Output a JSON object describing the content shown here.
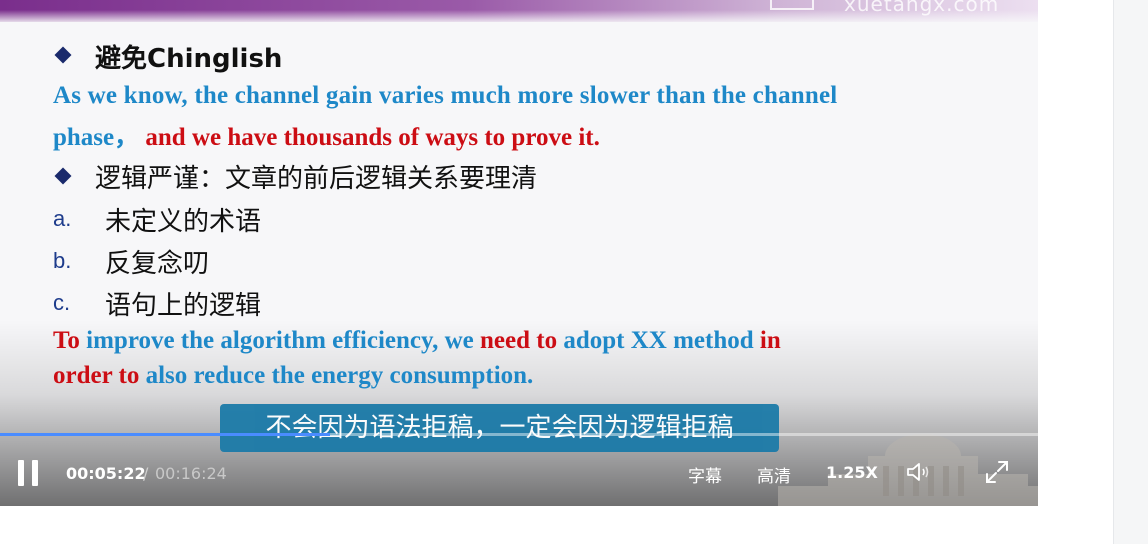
{
  "watermark": "xuetangx.com",
  "slide": {
    "heading1": "避免Chinglish",
    "example1_blue": "As we know, the channel gain varies much more slower than the channel",
    "example1_blue2": "phase，",
    "example1_red": "and we have thousands of ways to prove it.",
    "heading2": "逻辑严谨：文章的前后逻辑关系要理清",
    "items": [
      {
        "letter": "a.",
        "text": "未定义的术语"
      },
      {
        "letter": "b.",
        "text": "反复念叨"
      },
      {
        "letter": "c.",
        "text": "语句上的逻辑"
      }
    ],
    "example2": [
      {
        "text": "To",
        "color": "red"
      },
      {
        "text": " improve the algorithm efficiency, we ",
        "color": "blue"
      },
      {
        "text": "need to",
        "color": "red"
      },
      {
        "text": " adopt XX method ",
        "color": "blue"
      },
      {
        "text": "in",
        "color": "red"
      }
    ],
    "example2_line2": [
      {
        "text": "order to",
        "color": "red"
      },
      {
        "text": " also reduce the energy consumption.",
        "color": "blue"
      }
    ]
  },
  "subtitle": "不会因为语法拒稿，一定会因为逻辑拒稿",
  "player": {
    "progress_fraction": 0.318,
    "current_time": "00:05:22",
    "separator": "/",
    "total_time": "00:16:24",
    "subtitles_label": "字幕",
    "quality_label": "高清",
    "speed_label": "1.25X",
    "accent_color": "#4a8cff",
    "icons": [
      "pause-icon",
      "volume-icon",
      "fullscreen-icon"
    ]
  }
}
